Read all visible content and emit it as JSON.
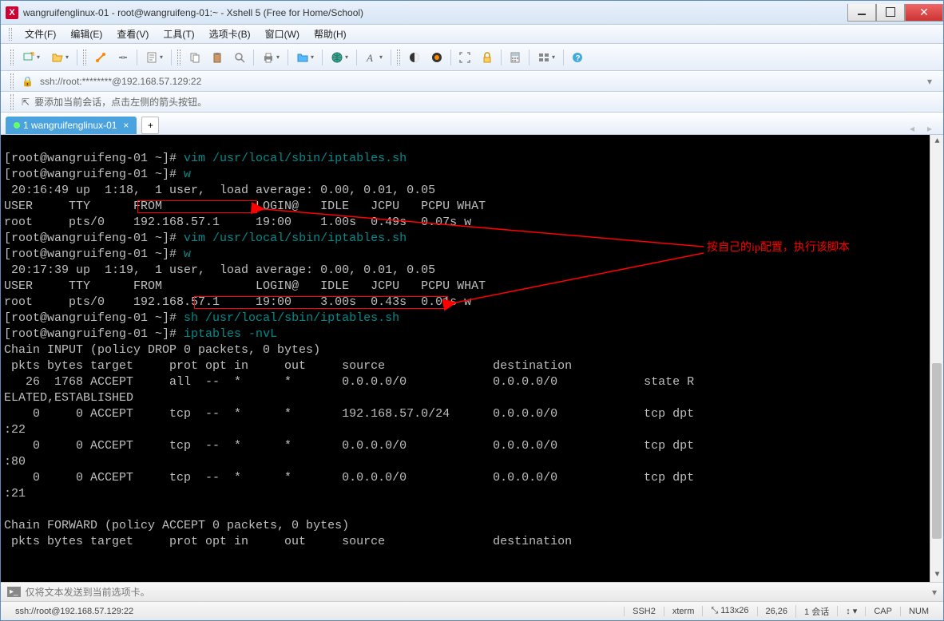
{
  "window": {
    "title": "wangruifenglinux-01 - root@wangruifeng-01:~ - Xshell 5 (Free for Home/School)"
  },
  "menu": {
    "file": "文件(F)",
    "edit": "编辑(E)",
    "view": "查看(V)",
    "tools": "工具(T)",
    "optcard": "选项卡(B)",
    "windows": "窗口(W)",
    "help": "帮助(H)"
  },
  "address": {
    "value": "ssh://root:********@192.168.57.129:22"
  },
  "tip": {
    "text": "要添加当前会话，点击左侧的箭头按钮。"
  },
  "tab": {
    "label": "1 wangruifenglinux-01"
  },
  "terminal_lines": [
    "[root@wangruifeng-01 ~]# vim /usr/local/sbin/iptables.sh",
    "[root@wangruifeng-01 ~]# w",
    " 20:16:49 up  1:18,  1 user,  load average: 0.00, 0.01, 0.05",
    "USER     TTY      FROM             LOGIN@   IDLE   JCPU   PCPU WHAT",
    "root     pts/0    192.168.57.1     19:00    1.00s  0.49s  0.07s w",
    "[root@wangruifeng-01 ~]# vim /usr/local/sbin/iptables.sh",
    "[root@wangruifeng-01 ~]# w",
    " 20:17:39 up  1:19,  1 user,  load average: 0.00, 0.01, 0.05",
    "USER     TTY      FROM             LOGIN@   IDLE   JCPU   PCPU WHAT",
    "root     pts/0    192.168.57.1     19:00    3.00s  0.43s  0.01s w",
    "[root@wangruifeng-01 ~]# sh /usr/local/sbin/iptables.sh",
    "[root@wangruifeng-01 ~]# iptables -nvL",
    "Chain INPUT (policy DROP 0 packets, 0 bytes)",
    " pkts bytes target     prot opt in     out     source               destination         ",
    "   26  1768 ACCEPT     all  --  *      *       0.0.0.0/0            0.0.0.0/0            state RELATED,ESTABLISHED",
    "    0     0 ACCEPT     tcp  --  *      *       192.168.57.0/24      0.0.0.0/0            tcp dpt:22",
    "    0     0 ACCEPT     tcp  --  *      *       0.0.0.0/0            0.0.0.0/0            tcp dpt:80",
    "    0     0 ACCEPT     tcp  --  *      *       0.0.0.0/0            0.0.0.0/0            tcp dpt:21",
    "",
    "Chain FORWARD (policy ACCEPT 0 packets, 0 bytes)",
    " pkts bytes target     prot opt in     out     source               destination         "
  ],
  "annotation": "按自己的ip配置，执行该脚本",
  "inputbar": {
    "placeholder": "仅将文本发送到当前选项卡。"
  },
  "status": {
    "conn": "ssh://root@192.168.57.129:22",
    "proto": "SSH2",
    "term": "xterm",
    "size": "113x26",
    "caret": "26,26",
    "sess": "1 会话",
    "cap": "CAP",
    "num": "NUM"
  }
}
